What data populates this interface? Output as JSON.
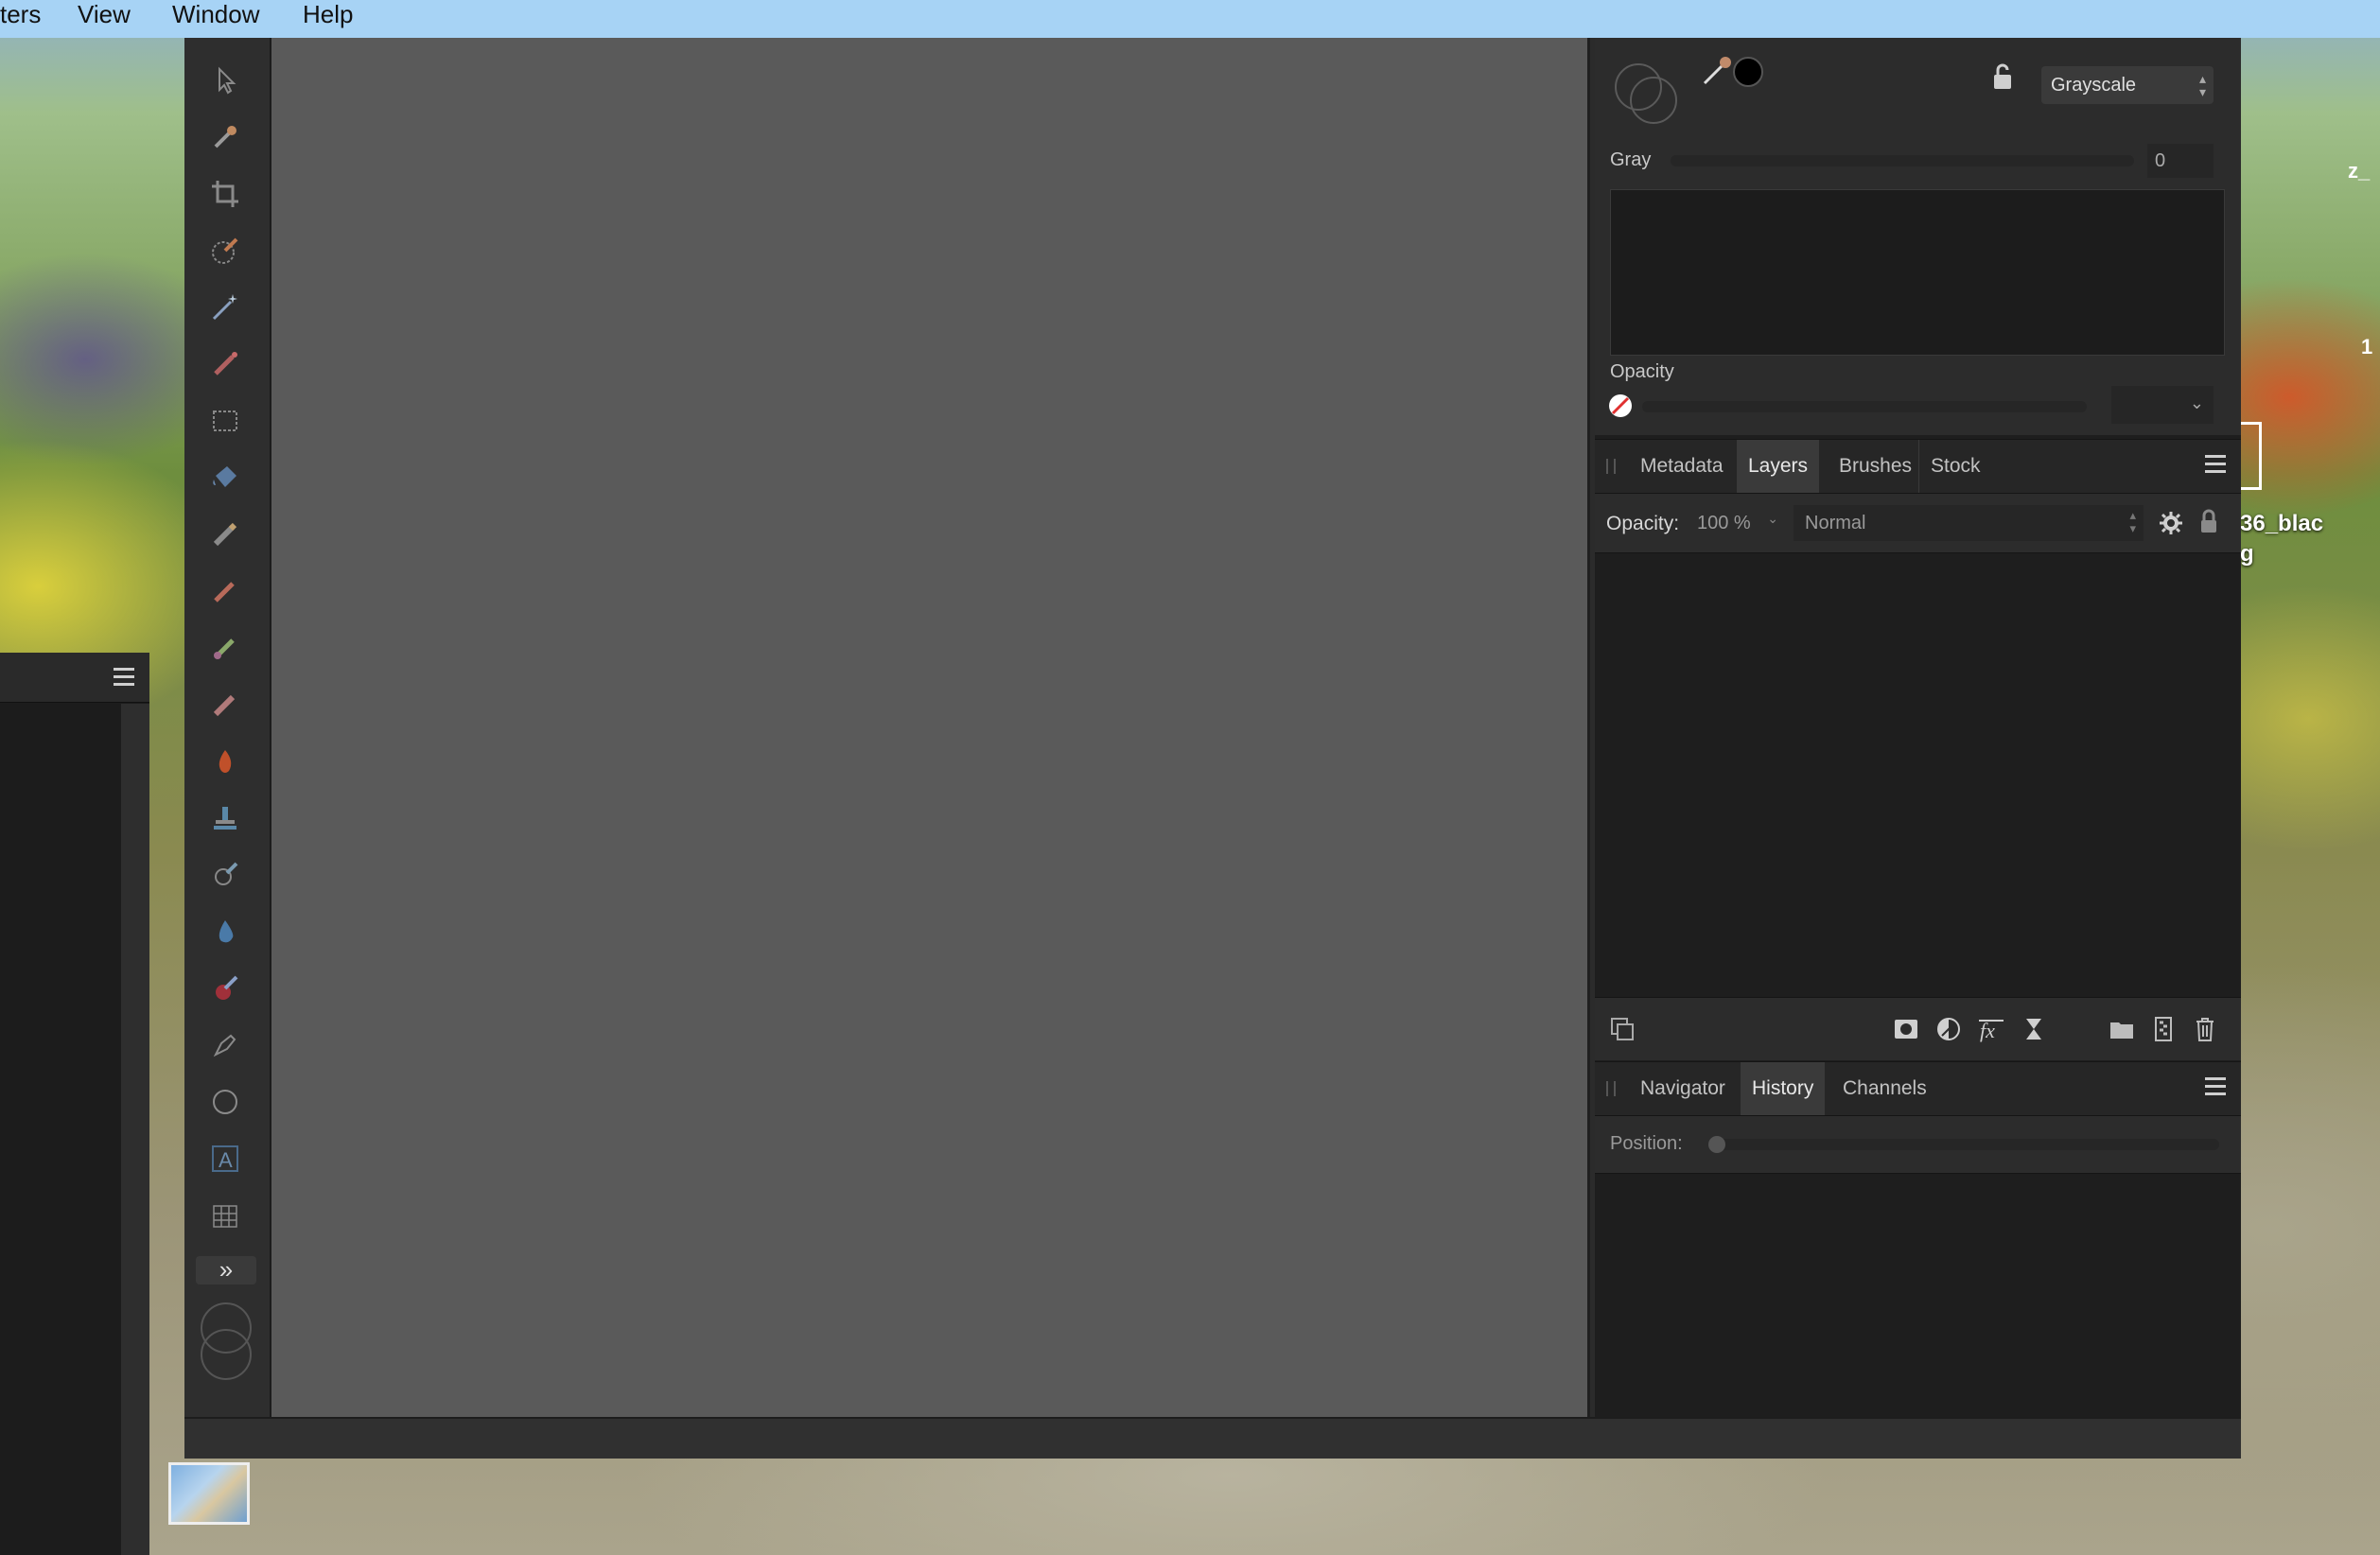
{
  "menubar": {
    "items": [
      "ters",
      "View",
      "Window",
      "Help"
    ]
  },
  "desktop": {
    "partial_labels": [
      "z_",
      "1",
      "36_blac",
      "g"
    ]
  },
  "toolbar": {
    "tools": [
      "move-tool-icon",
      "color-picker-tool-icon",
      "crop-tool-icon",
      "selection-brush-tool-icon",
      "flood-select-tool-icon",
      "paint-brush-tool-icon",
      "rectangular-marquee-tool-icon",
      "fill-tool-icon",
      "erase-brush-tool-icon",
      "pixel-tool-icon",
      "paint-mixer-tool-icon",
      "clone-brush-tool-icon",
      "burn-brush-tool-icon",
      "healing-brush-tool-icon",
      "blemish-removal-tool-icon",
      "blur-brush-tool-icon",
      "red-eye-tool-icon",
      "pen-tool-icon",
      "ellipse-tool-icon",
      "artistic-text-tool-icon",
      "mesh-warp-tool-icon"
    ],
    "expand_label": "»"
  },
  "color_panel": {
    "mode": "Grayscale",
    "gray_label": "Gray",
    "gray_value": "0",
    "opacity_label": "Opacity"
  },
  "layers_panel": {
    "tabs": [
      "Metadata",
      "Layers",
      "Brushes",
      "Stock"
    ],
    "active_tab": "Layers",
    "opacity_label": "Opacity:",
    "opacity_value": "100 %",
    "blend_mode": "Normal"
  },
  "history_panel": {
    "tabs": [
      "Navigator",
      "History",
      "Channels"
    ],
    "active_tab": "History",
    "position_label": "Position:"
  },
  "colors": {
    "menubar": "#a7d3f5",
    "panel_bg": "#1e1e1e",
    "canvas": "#5a5a5a"
  }
}
